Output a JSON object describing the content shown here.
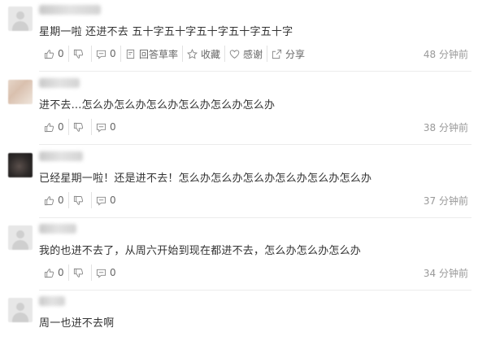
{
  "comments": [
    {
      "content": "星期一啦 还进不去 五十字五十字五十字五十字五十字",
      "likes": "0",
      "dislikes": "0",
      "replies": "0",
      "reply_label": "回答草率",
      "favorite_label": "收藏",
      "thanks_label": "感谢",
      "share_label": "分享",
      "time": "48 分钟前"
    },
    {
      "content": "进不去...怎么办怎么办怎么办怎么办怎么办怎么办",
      "likes": "0",
      "dislikes": "0",
      "replies": "0",
      "time": "38 分钟前"
    },
    {
      "content": "已经星期一啦！还是进不去！怎么办怎么办怎么办怎么办怎么办怎么办",
      "likes": "0",
      "dislikes": "0",
      "replies": "0",
      "time": "37 分钟前"
    },
    {
      "content": "我的也进不去了，从周六开始到现在都进不去，怎么办怎么办怎么办",
      "likes": "0",
      "dislikes": "0",
      "replies": "0",
      "time": "34 分钟前"
    },
    {
      "content": "周一也进不去啊"
    }
  ],
  "icons": {
    "like": "thumbs-up-icon",
    "dislike": "thumbs-down-icon",
    "reply": "comment-bubble-icon",
    "report": "report-icon",
    "favorite": "star-icon",
    "thanks": "heart-icon",
    "share": "share-icon"
  },
  "colors": {
    "text": "#333333",
    "meta": "#666666",
    "time": "#999999",
    "divider": "#ececec"
  }
}
